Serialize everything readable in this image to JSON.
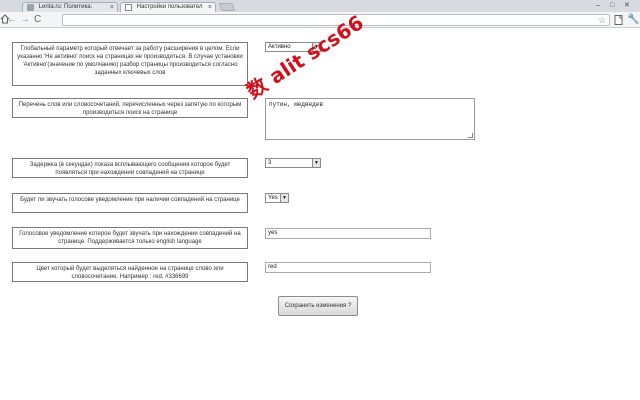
{
  "browser": {
    "tabs": [
      {
        "title": "Lenta.ru: Политика:",
        "active": false
      },
      {
        "title": "Настройки пользовател",
        "active": true
      }
    ],
    "tab_close_glyph": "×",
    "window_controls": {
      "minimize": "–",
      "maximize": "□",
      "close": "✕"
    },
    "nav_glyphs": {
      "back": "←",
      "forward": "→",
      "reload": "C"
    },
    "star_glyph": "☆",
    "wrench_glyph": "🔧"
  },
  "settings": {
    "search_enabled": {
      "label": "Глобальный параметр который отвечает за работу расширения в целом. Если указанно 'Не активно' поиск на страницах не производиться. В случае установки 'Активно'(значение по умолчанию) разбор страницы производиться согласно заданных ключевых слов",
      "value": "Активно"
    },
    "keywords": {
      "label": "Перечень слов или словосочетаний, перечисленных через запятую по которым производиться поиск на странице",
      "value": "путин, медведев"
    },
    "popup_delay": {
      "label": "Задержка (в секундах) показа всплывающего сообщения которое будет появляться при нахождении совпадений на странице",
      "value": "3"
    },
    "sound_alert": {
      "label": "Будет ли звучать голосове уведомление при наличии совпадений на странице",
      "value": "Yes"
    },
    "voice_text": {
      "label": "Голосовое уведомление котерое будет звучать при нахождении совпадений на странице. Поддерживается только english language",
      "value": "yes"
    },
    "highlight_color": {
      "label": "Цвет который будет выделяться найденное на странице слово или словосочетание. Например : red, #336699",
      "value": "red"
    },
    "save_label": "Сохранить изменения ?",
    "select_arrow": "▼"
  },
  "watermark": "数 alit scs66",
  "colors": {
    "watermark": "#d0101b",
    "border": "#7a7a7a"
  }
}
